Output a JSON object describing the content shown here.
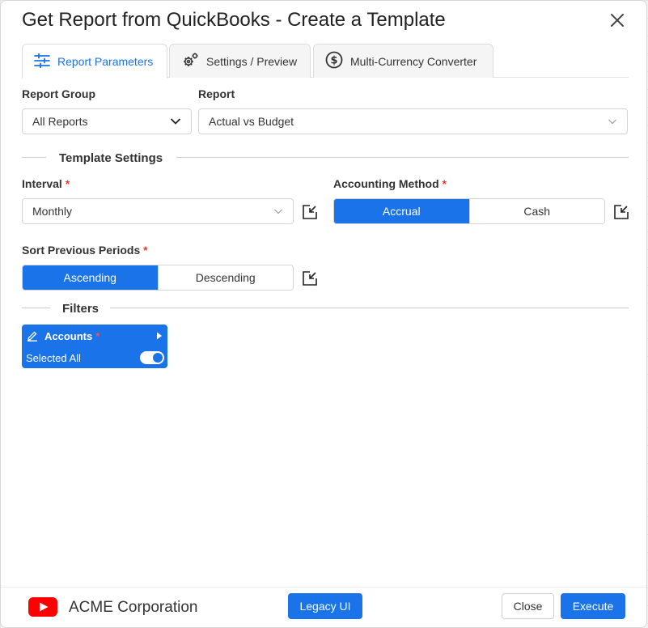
{
  "dialog": {
    "title": "Get Report from QuickBooks - Create a Template",
    "close_icon": "close-icon"
  },
  "tabs": [
    {
      "label": "Report Parameters",
      "icon": "sliders-icon",
      "active": true
    },
    {
      "label": "Settings / Preview",
      "icon": "gears-icon",
      "active": false
    },
    {
      "label": "Multi-Currency Converter",
      "icon": "dollar-circle-icon",
      "active": false
    }
  ],
  "report_group": {
    "label": "Report Group",
    "value": "All Reports"
  },
  "report": {
    "label": "Report",
    "value": "Actual vs Budget"
  },
  "template_settings": {
    "title": "Template Settings",
    "interval": {
      "label": "Interval",
      "required": "*",
      "value": "Monthly"
    },
    "accounting_method": {
      "label": "Accounting Method",
      "required": "*",
      "options": [
        "Accrual",
        "Cash"
      ],
      "selected": "Accrual"
    },
    "sort_previous_periods": {
      "label": "Sort Previous Periods",
      "required": "*",
      "options": [
        "Ascending",
        "Descending"
      ],
      "selected": "Ascending"
    }
  },
  "filters": {
    "title": "Filters",
    "accounts": {
      "label": "Accounts",
      "required": "*",
      "selected_text": "Selected All",
      "toggle_on": true
    }
  },
  "footer": {
    "company": "ACME Corporation",
    "legacy_label": "Legacy UI",
    "close_label": "Close",
    "execute_label": "Execute"
  },
  "colors": {
    "accent": "#1a73e8",
    "required": "#e53935",
    "logo_red": "#ff0000"
  }
}
